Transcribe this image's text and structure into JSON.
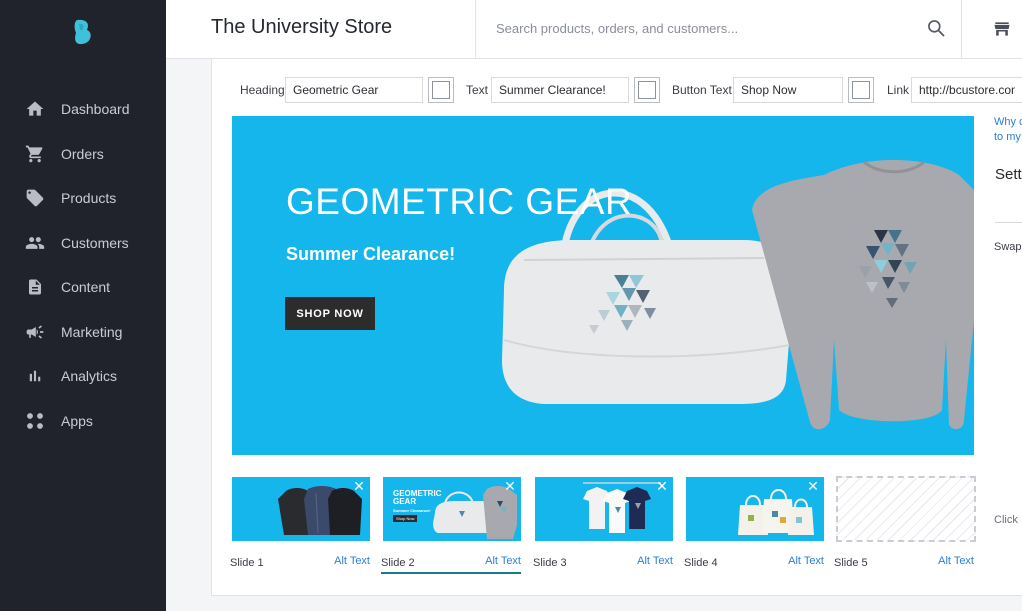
{
  "app": {
    "store_name": "The University Store"
  },
  "search": {
    "placeholder": "Search products, orders, and customers..."
  },
  "sidebar": {
    "items": [
      {
        "label": "Dashboard",
        "icon": "home-icon"
      },
      {
        "label": "Orders",
        "icon": "cart-icon"
      },
      {
        "label": "Products",
        "icon": "tag-icon"
      },
      {
        "label": "Customers",
        "icon": "people-icon"
      },
      {
        "label": "Content",
        "icon": "document-icon"
      },
      {
        "label": "Marketing",
        "icon": "megaphone-icon"
      },
      {
        "label": "Analytics",
        "icon": "bar-chart-icon"
      },
      {
        "label": "Apps",
        "icon": "apps-grid-icon"
      }
    ]
  },
  "editor": {
    "heading_label": "Heading",
    "heading_value": "Geometric Gear",
    "text_label": "Text",
    "text_value": "Summer Clearance!",
    "button_text_label": "Button Text",
    "button_text_value": "Shop Now",
    "link_label": "Link",
    "link_value": "http://bcustore.com/"
  },
  "banner": {
    "heading": "GEOMETRIC GEAR",
    "text": "Summer Clearance!",
    "button": "SHOP NOW"
  },
  "side_panel": {
    "link_line1": "Why c",
    "link_line2": "to my",
    "heading": "Sett",
    "swap_text": "Swap",
    "click_text": "Click"
  },
  "slides": [
    {
      "label": "Slide 1",
      "alt": "Alt Text",
      "active": false
    },
    {
      "label": "Slide 2",
      "alt": "Alt Text",
      "active": true,
      "thumb_heading": "GEOMETRIC GEAR",
      "thumb_text": "Summer Clearance!",
      "thumb_button": "Shop Now"
    },
    {
      "label": "Slide 3",
      "alt": "Alt Text",
      "active": false
    },
    {
      "label": "Slide 4",
      "alt": "Alt Text",
      "active": false
    },
    {
      "label": "Slide 5",
      "alt": "Alt Text",
      "active": false
    }
  ],
  "colors": {
    "sidebar_bg": "#20232b",
    "accent_blue": "#14b6eb",
    "link_blue": "#2a7fd3",
    "active_bar": "#1b7a8f"
  }
}
